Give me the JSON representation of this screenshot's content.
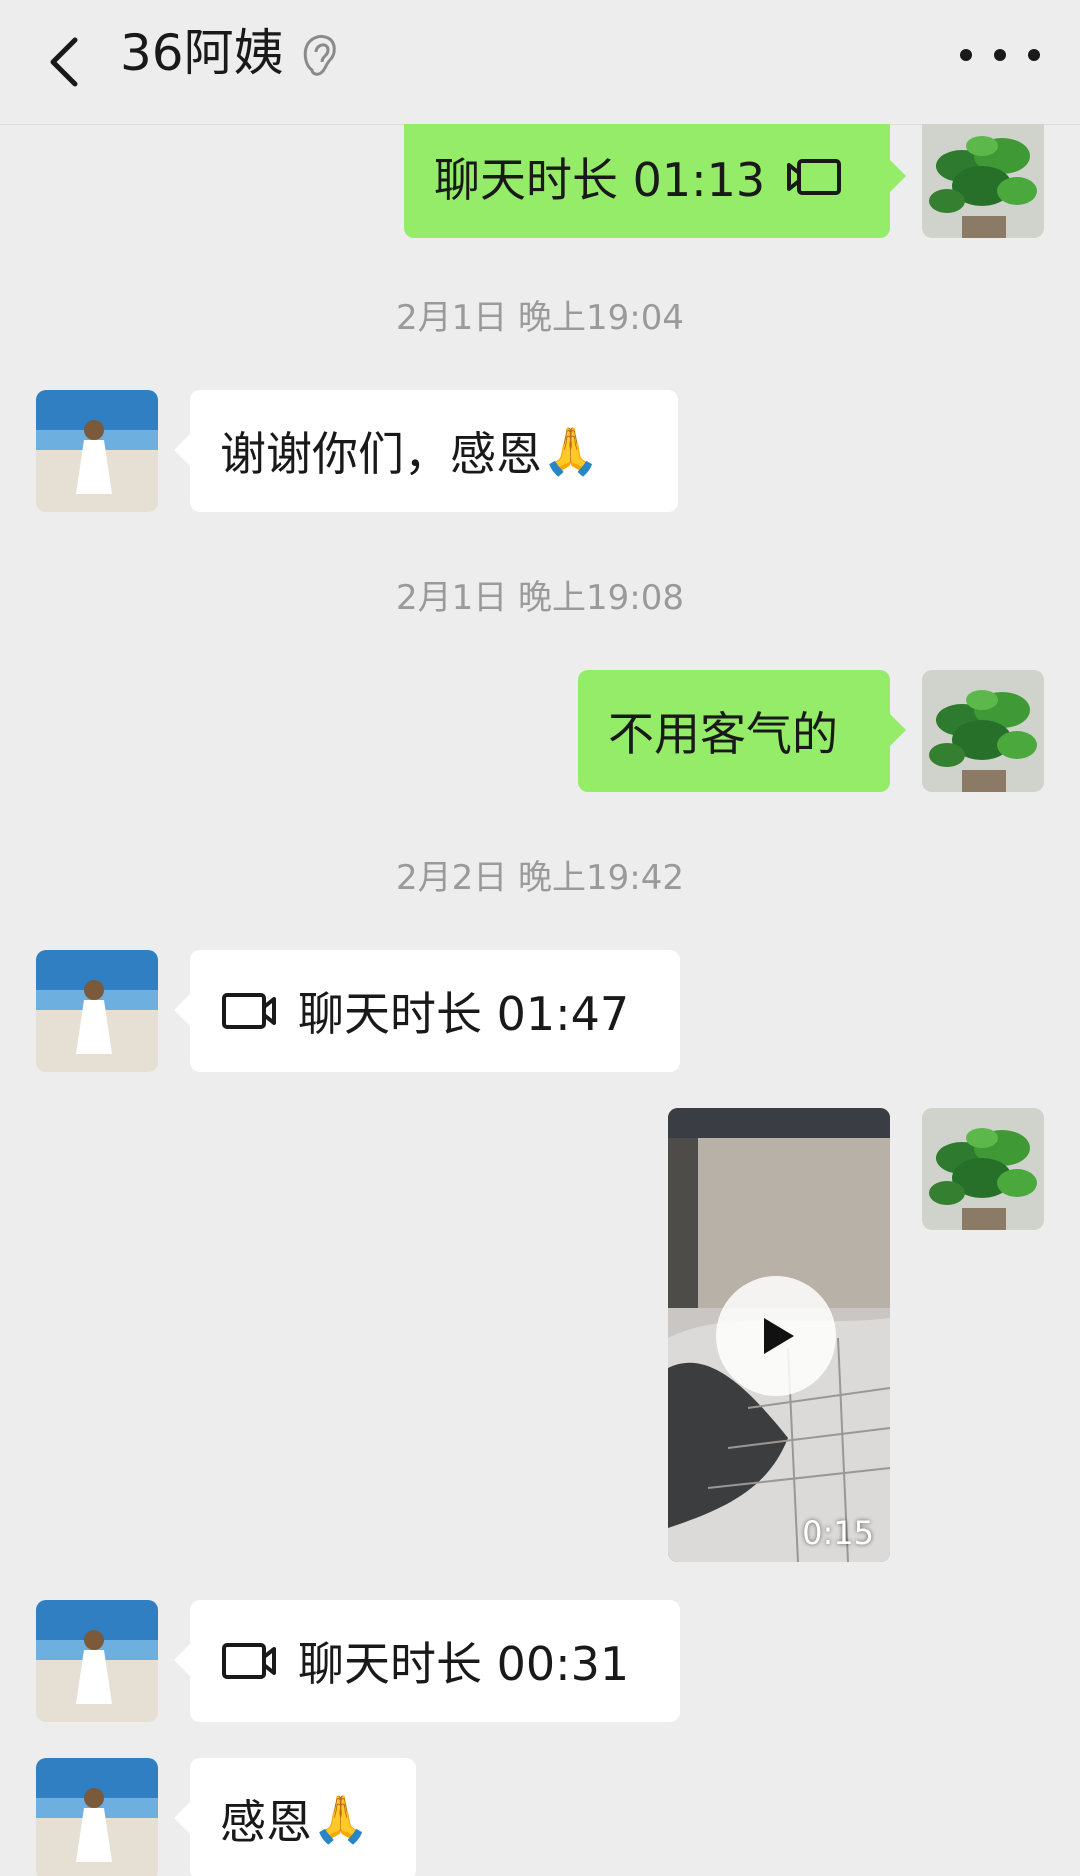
{
  "header": {
    "title": "36阿姨",
    "back_icon": "chevron-left-icon",
    "ear_icon": "ear-icon",
    "more_icon": "more-dots-icon"
  },
  "messages": [
    {
      "type": "call",
      "direction": "out",
      "text": "聊天时长 01:13",
      "icon": "video-call-icon"
    },
    {
      "type": "time",
      "text": "2月1日 晚上19:04"
    },
    {
      "type": "text",
      "direction": "in",
      "text": "谢谢你们，感恩",
      "emoji": "🙏"
    },
    {
      "type": "time",
      "text": "2月1日 晚上19:08"
    },
    {
      "type": "text",
      "direction": "out",
      "text": "不用客气的"
    },
    {
      "type": "time",
      "text": "2月2日 晚上19:42"
    },
    {
      "type": "call",
      "direction": "in",
      "text": "聊天时长 01:47",
      "icon": "video-call-icon"
    },
    {
      "type": "video",
      "direction": "out",
      "duration": "0:15"
    },
    {
      "type": "call",
      "direction": "in",
      "text": "聊天时长 00:31",
      "icon": "video-call-icon"
    },
    {
      "type": "text",
      "direction": "in",
      "text": "感恩",
      "emoji": "🙏"
    }
  ],
  "colors": {
    "background": "#ededed",
    "outgoing_bubble": "#95ec69",
    "incoming_bubble": "#ffffff",
    "timestamp": "#9a9a9a"
  }
}
